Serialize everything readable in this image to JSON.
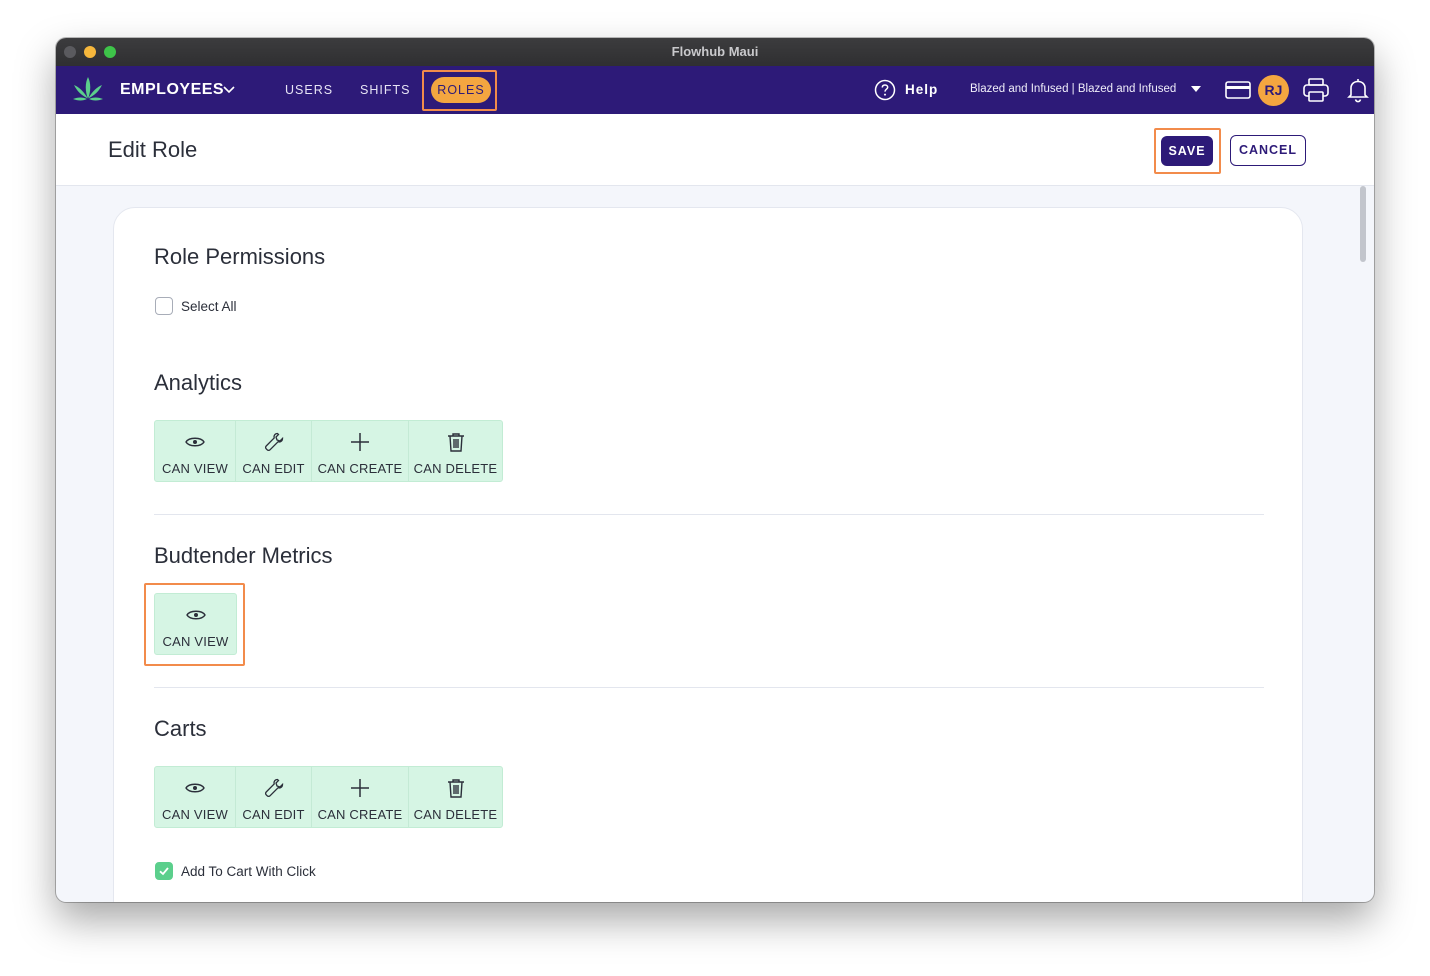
{
  "window": {
    "title": "Flowhub Maui"
  },
  "navbar": {
    "module": "EMPLOYEES",
    "links": [
      "USERS",
      "SHIFTS",
      "ROLES"
    ],
    "active_link": "ROLES",
    "help": "Help",
    "store": "Blazed and Infused | Blazed and Infused",
    "avatar_initials": "RJ"
  },
  "header": {
    "title": "Edit Role",
    "save": "SAVE",
    "cancel": "CANCEL"
  },
  "permissions": {
    "title": "Role Permissions",
    "select_all": "Select All",
    "sections": [
      {
        "title": "Analytics",
        "perms": [
          "CAN VIEW",
          "CAN EDIT",
          "CAN CREATE",
          "CAN DELETE"
        ]
      },
      {
        "title": "Budtender Metrics",
        "perms": [
          "CAN VIEW"
        ]
      },
      {
        "title": "Carts",
        "perms": [
          "CAN VIEW",
          "CAN EDIT",
          "CAN CREATE",
          "CAN DELETE"
        ],
        "option": "Add To Cart With Click",
        "option_checked": true
      }
    ]
  },
  "colors": {
    "nav": "#2d1a78",
    "accent": "#f4a640",
    "perm_bg": "#d6f5e4",
    "highlight": "#f28b4b"
  }
}
